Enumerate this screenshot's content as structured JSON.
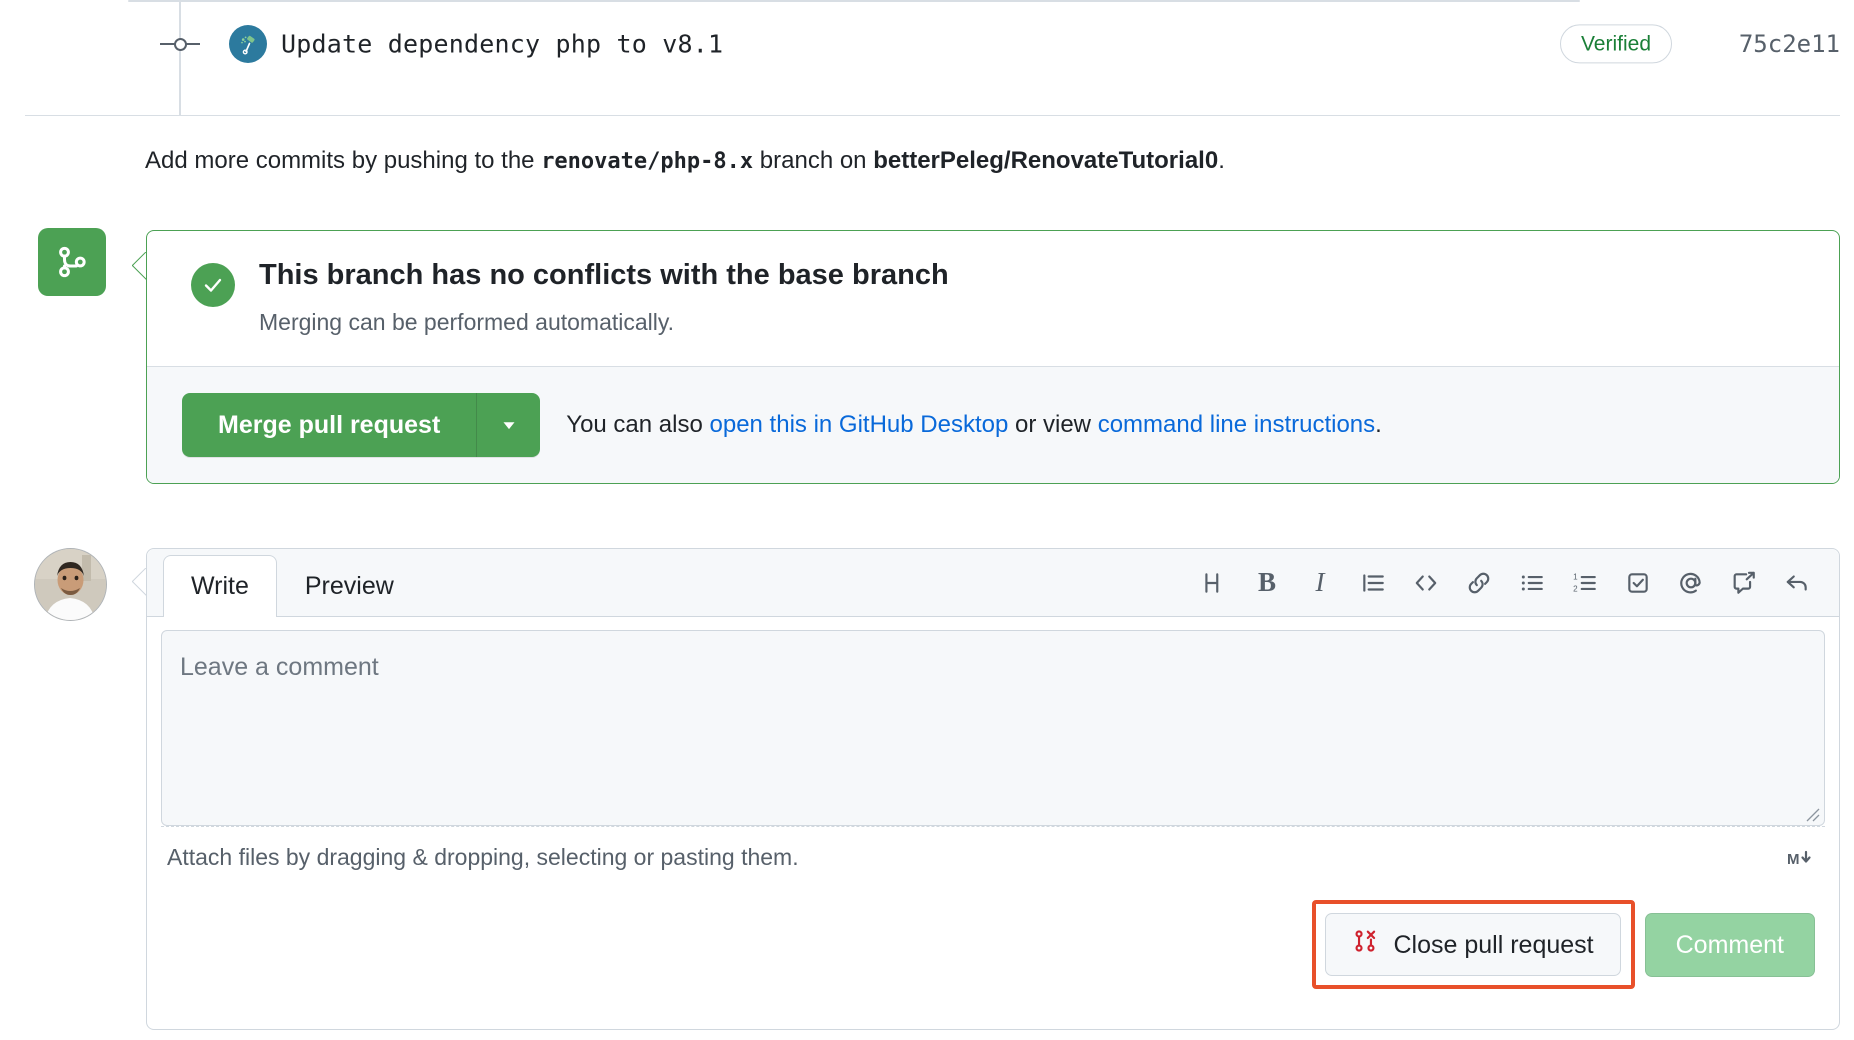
{
  "commit": {
    "title": "Update dependency php to v8.1",
    "verified_label": "Verified",
    "sha": "75c2e11",
    "author_avatar": "renovate-bot-avatar"
  },
  "push_hint": {
    "prefix": "Add more commits by pushing to the ",
    "branch": "renovate/php-8.x",
    "middle": " branch on ",
    "repo": "betterPeleg/RenovateTutorial0",
    "suffix": "."
  },
  "merge_box": {
    "icon": "git-merge-icon",
    "status_icon": "check-icon",
    "title": "This branch has no conflicts with the base branch",
    "subtitle": "Merging can be performed automatically.",
    "merge_button_label": "Merge pull request",
    "dropdown_icon": "triangle-down-icon",
    "alt_text_prefix": "You can also ",
    "alt_link_1": "open this in GitHub Desktop",
    "alt_text_middle": " or view ",
    "alt_link_2": "command line instructions",
    "alt_text_suffix": ".",
    "border_color": "#4ca154",
    "button_color": "#4ca154"
  },
  "comment_form": {
    "avatar": "user-avatar",
    "tabs": [
      {
        "label": "Write",
        "active": true
      },
      {
        "label": "Preview",
        "active": false
      }
    ],
    "toolbar": [
      {
        "name": "heading-icon",
        "glyph": "H",
        "title": "Add heading text"
      },
      {
        "name": "bold-icon",
        "glyph": "B",
        "title": "Add bold text"
      },
      {
        "name": "italic-icon",
        "glyph": "I",
        "title": "Add italic text"
      },
      {
        "name": "quote-icon",
        "glyph": "",
        "title": "Add a quote"
      },
      {
        "name": "code-icon",
        "glyph": "",
        "title": "Add code"
      },
      {
        "name": "link-icon",
        "glyph": "",
        "title": "Add a link"
      },
      {
        "name": "unordered-list-icon",
        "glyph": "",
        "title": "Add a bulleted list"
      },
      {
        "name": "ordered-list-icon",
        "glyph": "",
        "title": "Add a numbered list"
      },
      {
        "name": "task-list-icon",
        "glyph": "",
        "title": "Add a task list"
      },
      {
        "name": "mention-icon",
        "glyph": "@",
        "title": "Mention a user or team"
      },
      {
        "name": "saved-reply-icon",
        "glyph": "",
        "title": "Reference an issue or pull request"
      },
      {
        "name": "reply-icon",
        "glyph": "",
        "title": "Reply"
      }
    ],
    "textarea_placeholder": "Leave a comment",
    "textarea_value": "",
    "attach_text": "Attach files by dragging & dropping, selecting or pasting them.",
    "markdown_badge": "markdown-icon",
    "close_pr_label": "Close pull request",
    "close_pr_icon": "pull-request-closed-icon",
    "comment_label": "Comment",
    "comment_disabled": true,
    "highlight_color": "#e8502a",
    "comment_button_color": "#94d3a2"
  }
}
